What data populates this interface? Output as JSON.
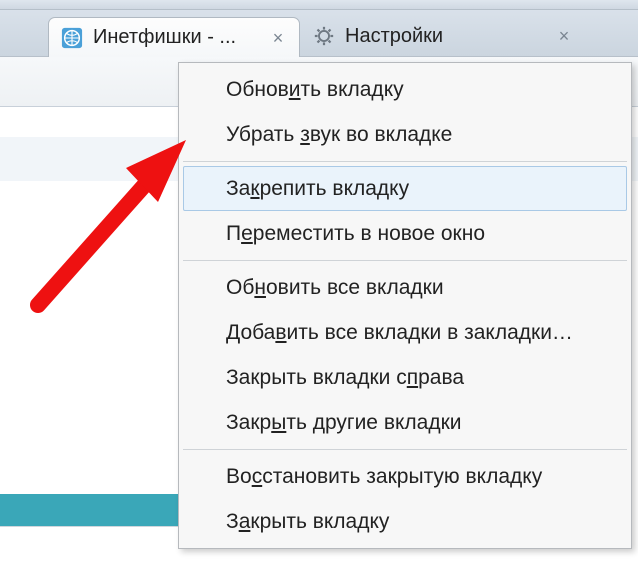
{
  "tabs": {
    "active": {
      "title": "Инетфишки - ...",
      "close": "×"
    },
    "inactive": {
      "title": "Настройки",
      "close": "×"
    }
  },
  "menu": {
    "reload_tab": "Обновить вкладку",
    "mute_tab": "Убрать звук во вкладке",
    "pin_tab": "Закрепить вкладку",
    "move_new_window": "Переместить в новое окно",
    "reload_all": "Обновить все вкладки",
    "bookmark_all": "Добавить все вкладки в закладки…",
    "close_right": "Закрыть вкладки справа",
    "close_others": "Закрыть другие вкладки",
    "undo_close": "Восстановить закрытую вкладку",
    "close_tab": "Закрыть вкладку"
  }
}
